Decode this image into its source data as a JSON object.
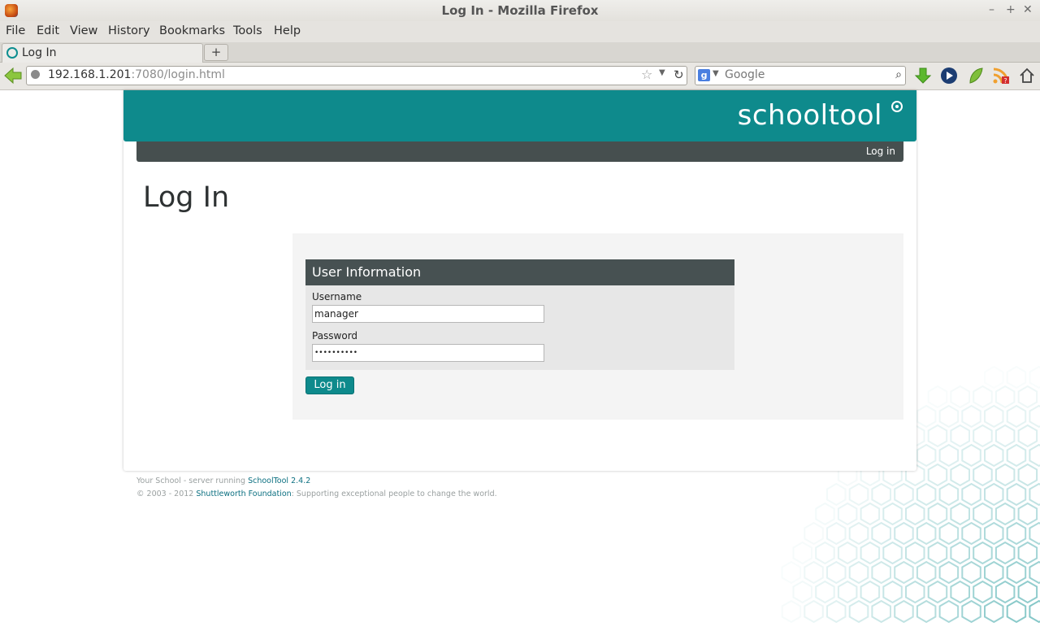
{
  "window": {
    "title": "Log In - Mozilla Firefox"
  },
  "menu": [
    "File",
    "Edit",
    "View",
    "History",
    "Bookmarks",
    "Tools",
    "Help"
  ],
  "tab": {
    "label": "Log In",
    "new_tab": "+"
  },
  "address": {
    "host": "192.168.1.201",
    "rest": ":7080/login.html"
  },
  "search": {
    "placeholder": "Google"
  },
  "site": {
    "logo": "schooltool",
    "nav_login": "Log in",
    "page_title": "Log In",
    "section_title": "User Information",
    "username_label": "Username",
    "username_value": "manager",
    "password_label": "Password",
    "password_value": "••••••••••",
    "login_button": "Log in"
  },
  "footer": {
    "line1_prefix": "Your School - server running ",
    "line1_link": "SchoolTool 2.4.2",
    "line2_prefix": "© 2003 - 2012 ",
    "line2_link": "Shuttleworth Foundation",
    "line2_suffix": ": Supporting exceptional people to change the world."
  },
  "colors": {
    "brand": "#0e8a8c",
    "nav": "#464f4f",
    "section": "#475152"
  },
  "icons": [
    "firefox-icon",
    "back-arrow-icon",
    "globe-icon",
    "star-icon",
    "reload-icon",
    "google-icon",
    "search-icon",
    "download-icon",
    "media-icon",
    "leaf-icon",
    "rss-icon",
    "home-icon"
  ]
}
